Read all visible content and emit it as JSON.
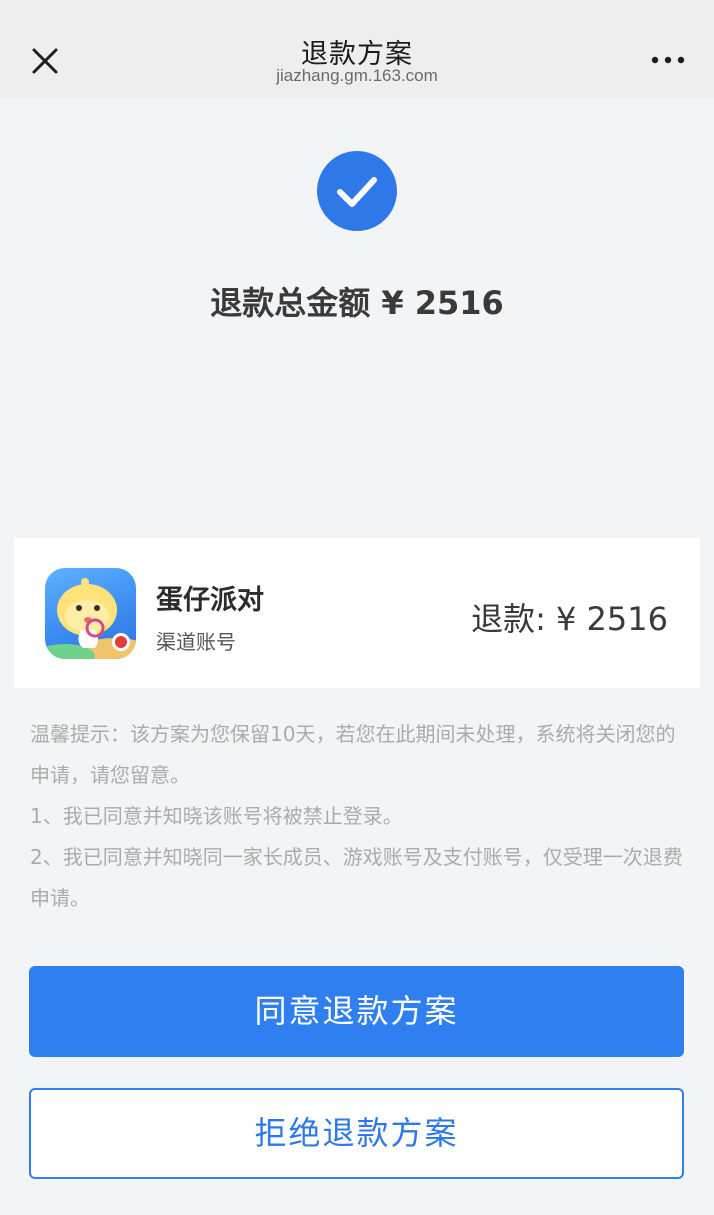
{
  "nav": {
    "title": "退款方案",
    "url": "jiazhang.gm.163.com",
    "close_icon": "close-icon",
    "more_icon": "more-horizontal-icon"
  },
  "status": {
    "icon": "check-circle-icon",
    "total_text": "退款总金额 ¥ 2516"
  },
  "card": {
    "app_icon": "game-app-icon",
    "app_name": "蛋仔派对",
    "account_type": "渠道账号",
    "refund_text": "退款: ¥ 2516"
  },
  "notice": {
    "lines": [
      "温馨提示：该方案为您保留10天，若您在此期间未处理，系统将关闭您的申请，请您留意。",
      "1、我已同意并知晓该账号将被禁止登录。",
      "2、我已同意并知晓同一家长成员、游戏账号及支付账号，仅受理一次退费申请。"
    ]
  },
  "actions": {
    "agree_label": "同意退款方案",
    "reject_label": "拒绝退款方案"
  },
  "colors": {
    "accent": "#2f7ff0",
    "background": "#f3f4f6",
    "navbar": "#eeeeef",
    "notice_text": "#ababab"
  }
}
